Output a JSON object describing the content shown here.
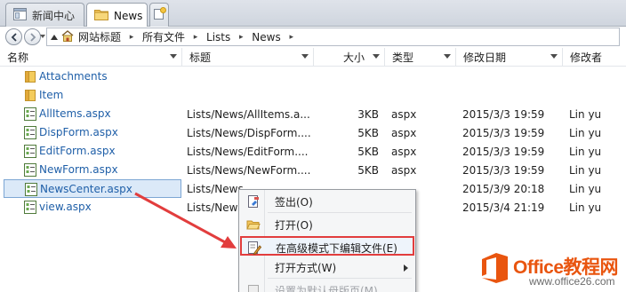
{
  "tabs": [
    {
      "label": "新闻中心",
      "active": false
    },
    {
      "label": "News",
      "active": true
    }
  ],
  "breadcrumb": [
    "网站标题",
    "所有文件",
    "Lists",
    "News"
  ],
  "columns": {
    "name": "名称",
    "title": "标题",
    "size": "大小",
    "type": "类型",
    "modified": "修改日期",
    "modified_by": "修改者"
  },
  "rows": [
    {
      "name": "Attachments",
      "icon": "folder-icon",
      "title": "",
      "size": "",
      "type": "",
      "modified": "",
      "modified_by": ""
    },
    {
      "name": "Item",
      "icon": "folder-icon",
      "title": "",
      "size": "",
      "type": "",
      "modified": "",
      "modified_by": ""
    },
    {
      "name": "AllItems.aspx",
      "icon": "aspx-file-icon",
      "title": "Lists/News/AllItems.a...",
      "size": "3KB",
      "type": "aspx",
      "modified": "2015/3/3 19:59",
      "modified_by": "Lin yu"
    },
    {
      "name": "DispForm.aspx",
      "icon": "aspx-file-icon",
      "title": "Lists/News/DispForm....",
      "size": "5KB",
      "type": "aspx",
      "modified": "2015/3/3 19:59",
      "modified_by": "Lin yu"
    },
    {
      "name": "EditForm.aspx",
      "icon": "aspx-file-icon",
      "title": "Lists/News/EditForm....",
      "size": "5KB",
      "type": "aspx",
      "modified": "2015/3/3 19:59",
      "modified_by": "Lin yu"
    },
    {
      "name": "NewForm.aspx",
      "icon": "aspx-file-icon",
      "title": "Lists/News/NewForm....",
      "size": "5KB",
      "type": "aspx",
      "modified": "2015/3/3 19:59",
      "modified_by": "Lin yu"
    },
    {
      "name": "NewsCenter.aspx",
      "icon": "aspx-file-icon",
      "title": "Lists/News",
      "size": "",
      "type": "",
      "modified": "2015/3/9 20:18",
      "modified_by": "Lin yu",
      "selected": true
    },
    {
      "name": "view.aspx",
      "icon": "aspx-file-icon",
      "title": "Lists/News",
      "size": "",
      "type": "",
      "modified": "2015/3/4 21:19",
      "modified_by": "Lin yu"
    }
  ],
  "context_menu": [
    {
      "label": "签出(O)",
      "icon": "checkout-icon"
    },
    {
      "label": "打开(O)",
      "icon": "open-folder-icon"
    },
    {
      "label": "在高级模式下编辑文件(E)",
      "icon": "edit-file-icon",
      "highlighted": true
    },
    {
      "label": "打开方式(W)",
      "submenu": true
    },
    {
      "label": "设置为默认母版页(M)",
      "disabled": true
    }
  ],
  "logo": {
    "brand": "Office教程网",
    "url": "www.office26.com"
  },
  "colors": {
    "link_blue": "#1f5fa8",
    "highlight_red": "#e23d3d",
    "brand_orange": "#e9550f"
  }
}
